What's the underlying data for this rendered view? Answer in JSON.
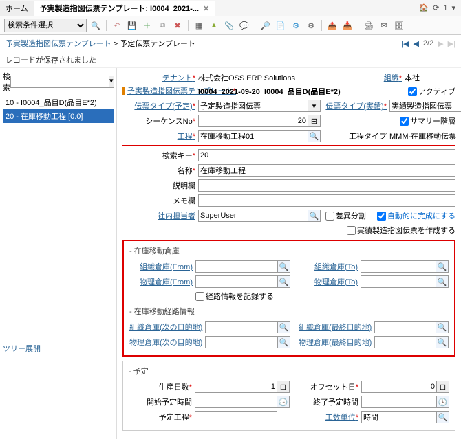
{
  "tabs": {
    "home": "ホーム",
    "active": "予実製造指図伝票テンプレート: I0004_2021-..."
  },
  "toolbar": {
    "search_select": "検索条件選択"
  },
  "breadcrumb": {
    "a": "予実製造指図伝票テンプレート",
    "b": "予定伝票テンプレート",
    "page": "2/2"
  },
  "status": "レコードが保存されました",
  "left": {
    "search_lbl": "検索",
    "item0": "10 - I0004_品目D(品目E*2)",
    "item1": "20 - 在庫移動工程 [0.0]",
    "tree_expand": "ツリー展開"
  },
  "f": {
    "tenant_lbl": "テナント",
    "tenant_val": "株式会社OSS ERP Solutions",
    "org_lbl": "組織",
    "org_val": "本社",
    "tmpl_lbl": "予実製造指図伝票テンプレート",
    "tmpl_val": "I0004_2021-09-20_I0004_品目D(品目E*2)",
    "active_lbl": "アクティブ",
    "type_plan_lbl": "伝票タイプ(予定)",
    "type_plan_val": "予定製造指図伝票",
    "type_act_lbl": "伝票タイプ(実績)",
    "type_act_val": "実績製造指図伝票",
    "seq_lbl": "シーケンスNo",
    "seq_val": "20",
    "summary_lbl": "サマリー階層",
    "proc_lbl": "工程",
    "proc_val": "在庫移動工程01",
    "proc_type_lbl": "工程タイプ",
    "proc_type_val": "MMM-在庫移動伝票",
    "key_lbl": "検索キー",
    "key_val": "20",
    "name_lbl": "名称",
    "name_val": "在庫移動工程",
    "desc_lbl": "説明欄",
    "memo_lbl": "メモ欄",
    "intrep_lbl": "社内担当者",
    "intrep_val": "SuperUser",
    "diff_lbl": "差異分割",
    "autocomp_lbl": "自動的に完成にする",
    "makeact_lbl": "実績製造指図伝票を作成する",
    "grp_wh": "- 在庫移動倉庫",
    "orgwh_from_lbl": "組織倉庫(From)",
    "orgwh_to_lbl": "組織倉庫(To)",
    "phywh_from_lbl": "物理倉庫(From)",
    "phywh_to_lbl": "物理倉庫(To)",
    "route_rec_lbl": "経路情報を記録する",
    "grp_route": "- 在庫移動経路情報",
    "orgwh_next_lbl": "組織倉庫(次の目的地)",
    "orgwh_last_lbl": "組織倉庫(最終目的地)",
    "phywh_next_lbl": "物理倉庫(次の目的地)",
    "phywh_last_lbl": "物理倉庫(最終目的地)",
    "grp_plan": "- 予定",
    "proddays_lbl": "生産日数",
    "proddays_val": "1",
    "offset_lbl": "オフセット日",
    "offset_val": "0",
    "start_lbl": "開始予定時間",
    "end_lbl": "終了予定時間",
    "plan_proc_lbl": "予定工程",
    "wku_lbl": "工数単位",
    "wku_val": "時間"
  }
}
